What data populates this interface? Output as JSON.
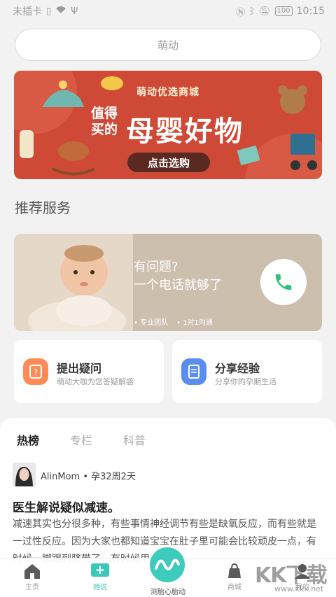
{
  "status": {
    "carrier": "未插卡",
    "time": "10:15",
    "battery": "100"
  },
  "search": {
    "placeholder": "萌动"
  },
  "banner": {
    "brand": "萌动优选商城",
    "sub": "值得买的",
    "headline": "母婴好物",
    "cta": "点击选购"
  },
  "recommend": {
    "title": "推荐服务",
    "service": {
      "line1": "有问题?",
      "line2": "一个电话就够了",
      "tag1": "• 专业团队",
      "tag2": "• 1对1沟通"
    }
  },
  "actions": [
    {
      "title": "提出疑问",
      "sub": "萌动大咖为您答疑解惑",
      "color": "#ff8a55"
    },
    {
      "title": "分享经验",
      "sub": "分享你的孕期生活",
      "color": "#5b8cf0"
    }
  ],
  "feed": {
    "tabs": [
      "热榜",
      "专栏",
      "科普"
    ],
    "post": {
      "author": "AlinMom",
      "meta": "• 孕32周2天",
      "title": "医生解说疑似减速。",
      "body": "减速其实也分很多种，有些事情神经调节有些是缺氧反应，而有些就是一过性反应。因为大家也都知道宝宝在肚子里可能会比较顽皮一点，有时候一脚踢到脐带了，有时候用手捏着"
    }
  },
  "tabbar": {
    "home": "主页",
    "talk": "她说",
    "center": "测胎心胎动",
    "mall": "商城",
    "mine": "我的"
  },
  "watermark": {
    "text": "KK下载",
    "url": "www.kkx.net"
  },
  "colors": {
    "accent": "#3dcbbb",
    "banner": "#cf4a36"
  }
}
